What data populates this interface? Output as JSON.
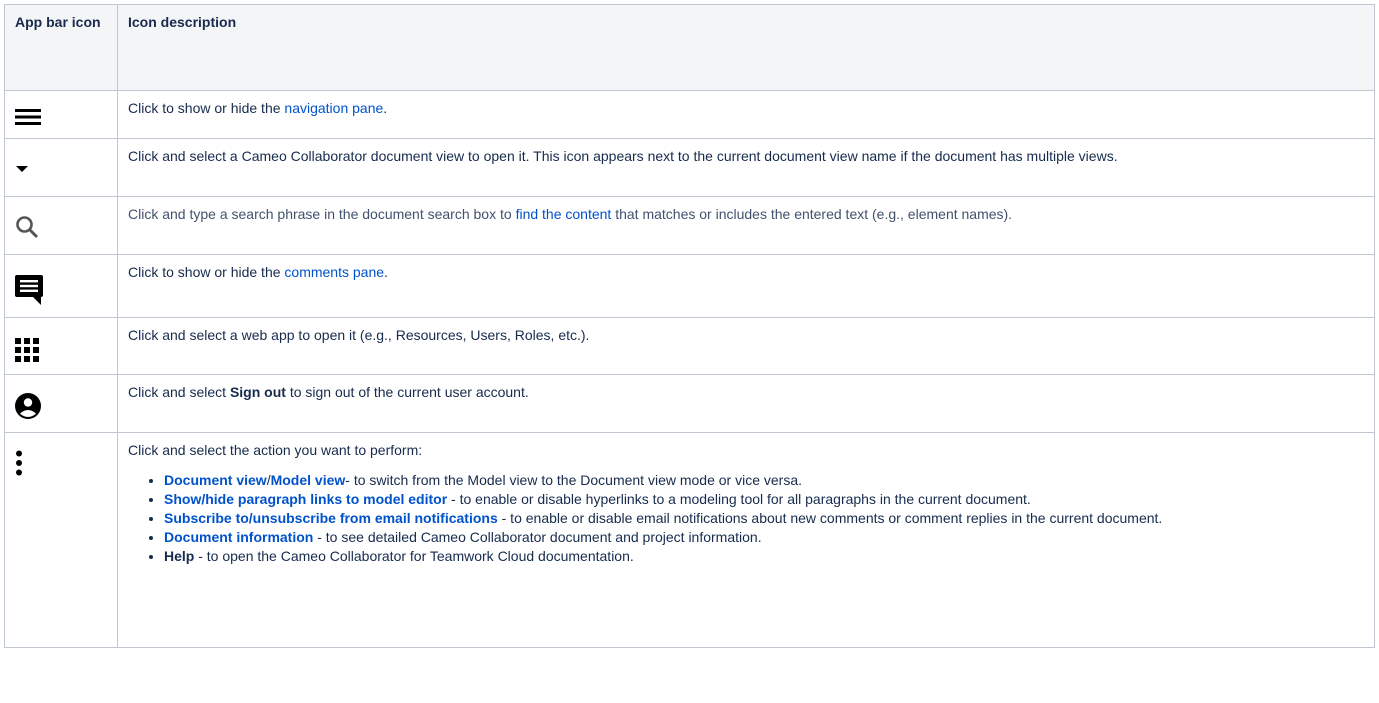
{
  "table": {
    "headers": {
      "icon": "App bar icon",
      "description": "Icon description"
    },
    "rows": [
      {
        "icon": "menu-icon",
        "prefix": "Click to show or hide the ",
        "link": "navigation pane",
        "suffix": "."
      },
      {
        "icon": "dropdown-arrow-icon",
        "text": "Click and select a Cameo Collaborator document view to open it. This icon appears next to the current document view name if the document has multiple views."
      },
      {
        "icon": "search-icon",
        "prefix": "Click and type a search phrase in the document search box to ",
        "link": "find the content",
        "suffix": " that matches or includes the entered text (e.g., element names)."
      },
      {
        "icon": "comment-icon",
        "prefix": "Click to show or hide the ",
        "link": "comments pane",
        "suffix": "."
      },
      {
        "icon": "apps-grid-icon",
        "text": "Click and select a web app to open it (e.g., Resources, Users, Roles, etc.)."
      },
      {
        "icon": "account-icon",
        "prefix": "Click and select ",
        "bold": "Sign out",
        "suffix": " to sign out of the current user account."
      },
      {
        "icon": "more-vert-icon",
        "intro": "Click and select the action you want to perform:",
        "actions": [
          {
            "link1": "Document view",
            "sep": "/",
            "link2": "Model view",
            "desc": "- to switch from the Model view to the Document view mode or vice versa."
          },
          {
            "link1": "Show/hide paragraph links to model editor",
            "desc": " - to enable or disable hyperlinks to a modeling tool for all paragraphs in the current document."
          },
          {
            "link1": "Subscribe to/unsubscribe from email notifications",
            "desc": " - to enable or disable email notifications about new comments or comment replies in the current document."
          },
          {
            "link1": "Document information",
            "desc": " - to see detailed Cameo Collaborator document and project information."
          },
          {
            "bold": "Help",
            "desc": " - to open the Cameo Collaborator for Teamwork Cloud documentation."
          }
        ]
      }
    ]
  },
  "colors": {
    "link": "#0052cc",
    "header_bg": "#f4f5f7",
    "border": "#c1c7d0",
    "icon": "#000000",
    "search_icon": "#555555"
  }
}
